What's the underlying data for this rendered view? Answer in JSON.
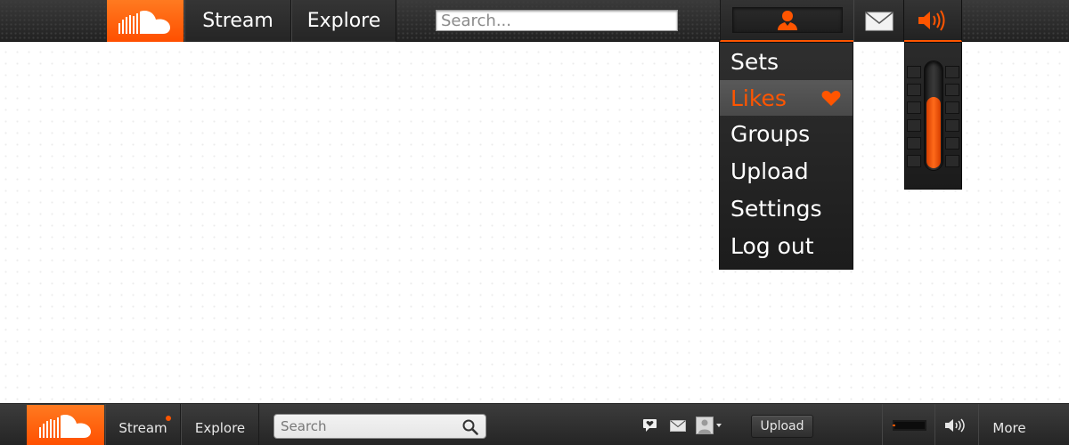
{
  "top_bar": {
    "nav": [
      {
        "label": "Stream"
      },
      {
        "label": "Explore"
      }
    ],
    "search": {
      "placeholder": "Search..."
    },
    "icons": {
      "logo": "soundcloud-logo-icon",
      "user": "user-icon",
      "mail": "mail-icon",
      "volume": "volume-icon"
    }
  },
  "user_menu": {
    "items": [
      {
        "label": "Sets"
      },
      {
        "label": "Likes",
        "active": true,
        "icon": "heart-icon"
      },
      {
        "label": "Groups"
      },
      {
        "label": "Upload"
      },
      {
        "label": "Settings"
      },
      {
        "label": "Log out"
      }
    ]
  },
  "volume_popup": {
    "level": 0.68
  },
  "bottom_bar": {
    "nav": [
      {
        "label": "Stream",
        "has_notification": true
      },
      {
        "label": "Explore"
      }
    ],
    "search": {
      "placeholder": "Search"
    },
    "upload_label": "Upload",
    "more_label": "More",
    "icons": {
      "logo": "soundcloud-logo-icon",
      "search": "search-icon",
      "comment": "comment-icon",
      "mail": "mail-icon",
      "avatar": "avatar-icon",
      "waveform": "waveform-icon",
      "volume": "volume-icon"
    }
  },
  "colors": {
    "accent": "#ff5500",
    "bar_dark": "#2e2e2e",
    "text_light": "#ffffff"
  }
}
